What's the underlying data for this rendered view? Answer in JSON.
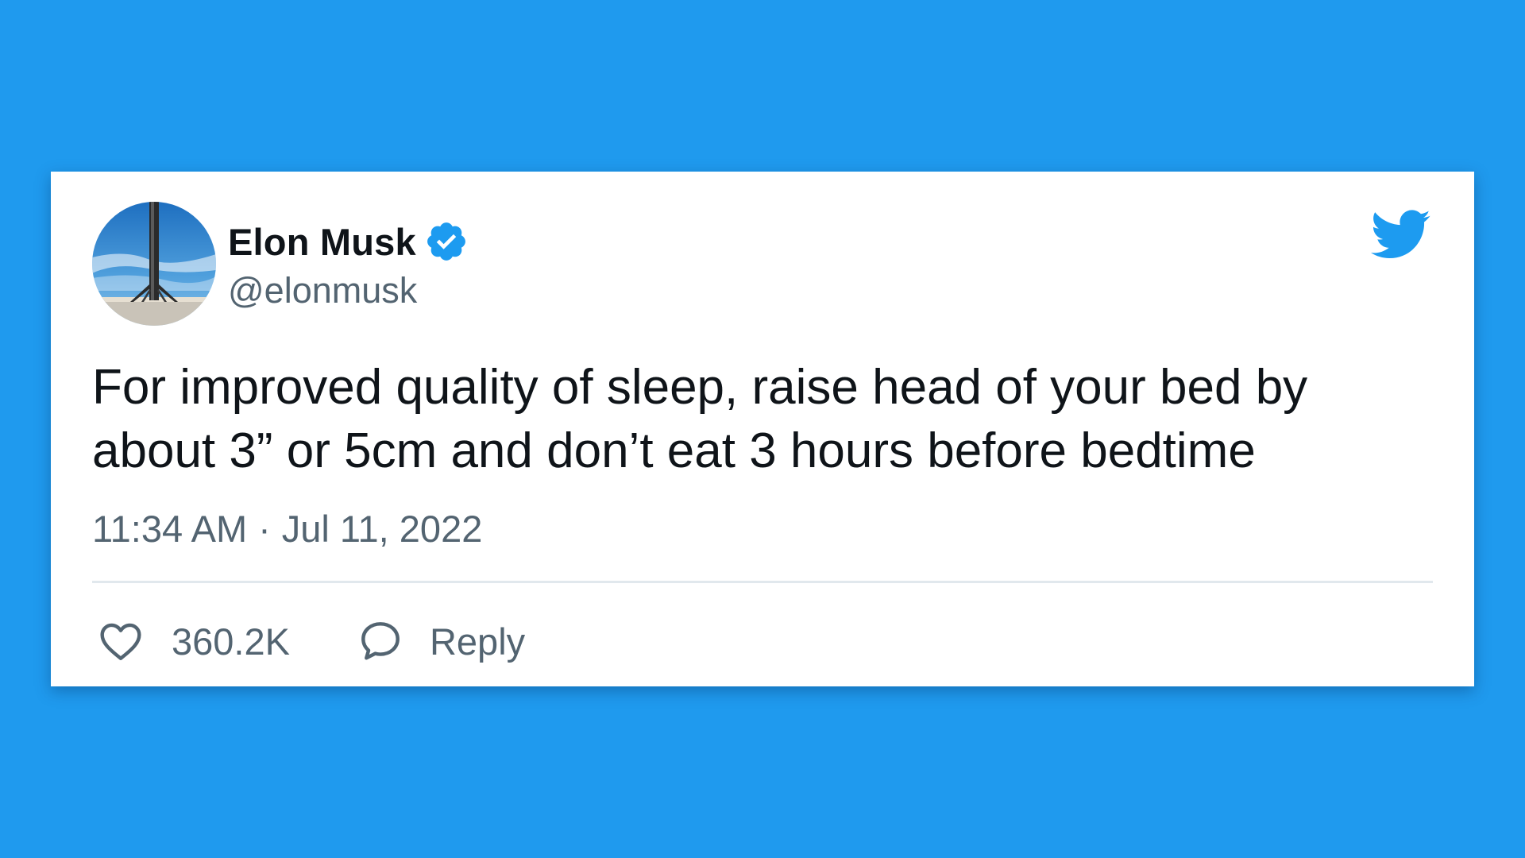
{
  "tweet": {
    "display_name": "Elon Musk",
    "handle": "@elonmusk",
    "verified_icon": "verified-badge-icon",
    "avatar": "rocket-booster-avatar",
    "brand_icon": "twitter-bird-icon",
    "text": "For improved quality of sleep, raise head of your bed by about 3” or 5cm and don’t eat 3 hours before bedtime",
    "time": "11:34 AM",
    "separator": "·",
    "date": "Jul 11, 2022",
    "actions": {
      "like_icon": "heart-icon",
      "like_count": "360.2K",
      "reply_icon": "speech-bubble-icon",
      "reply_label": "Reply"
    }
  },
  "colors": {
    "background": "#1f9aee",
    "card": "#ffffff",
    "text_primary": "#0f1419",
    "text_secondary": "#536471",
    "twitter_blue": "#1d9bf0",
    "divider": "#e1e8ed"
  }
}
